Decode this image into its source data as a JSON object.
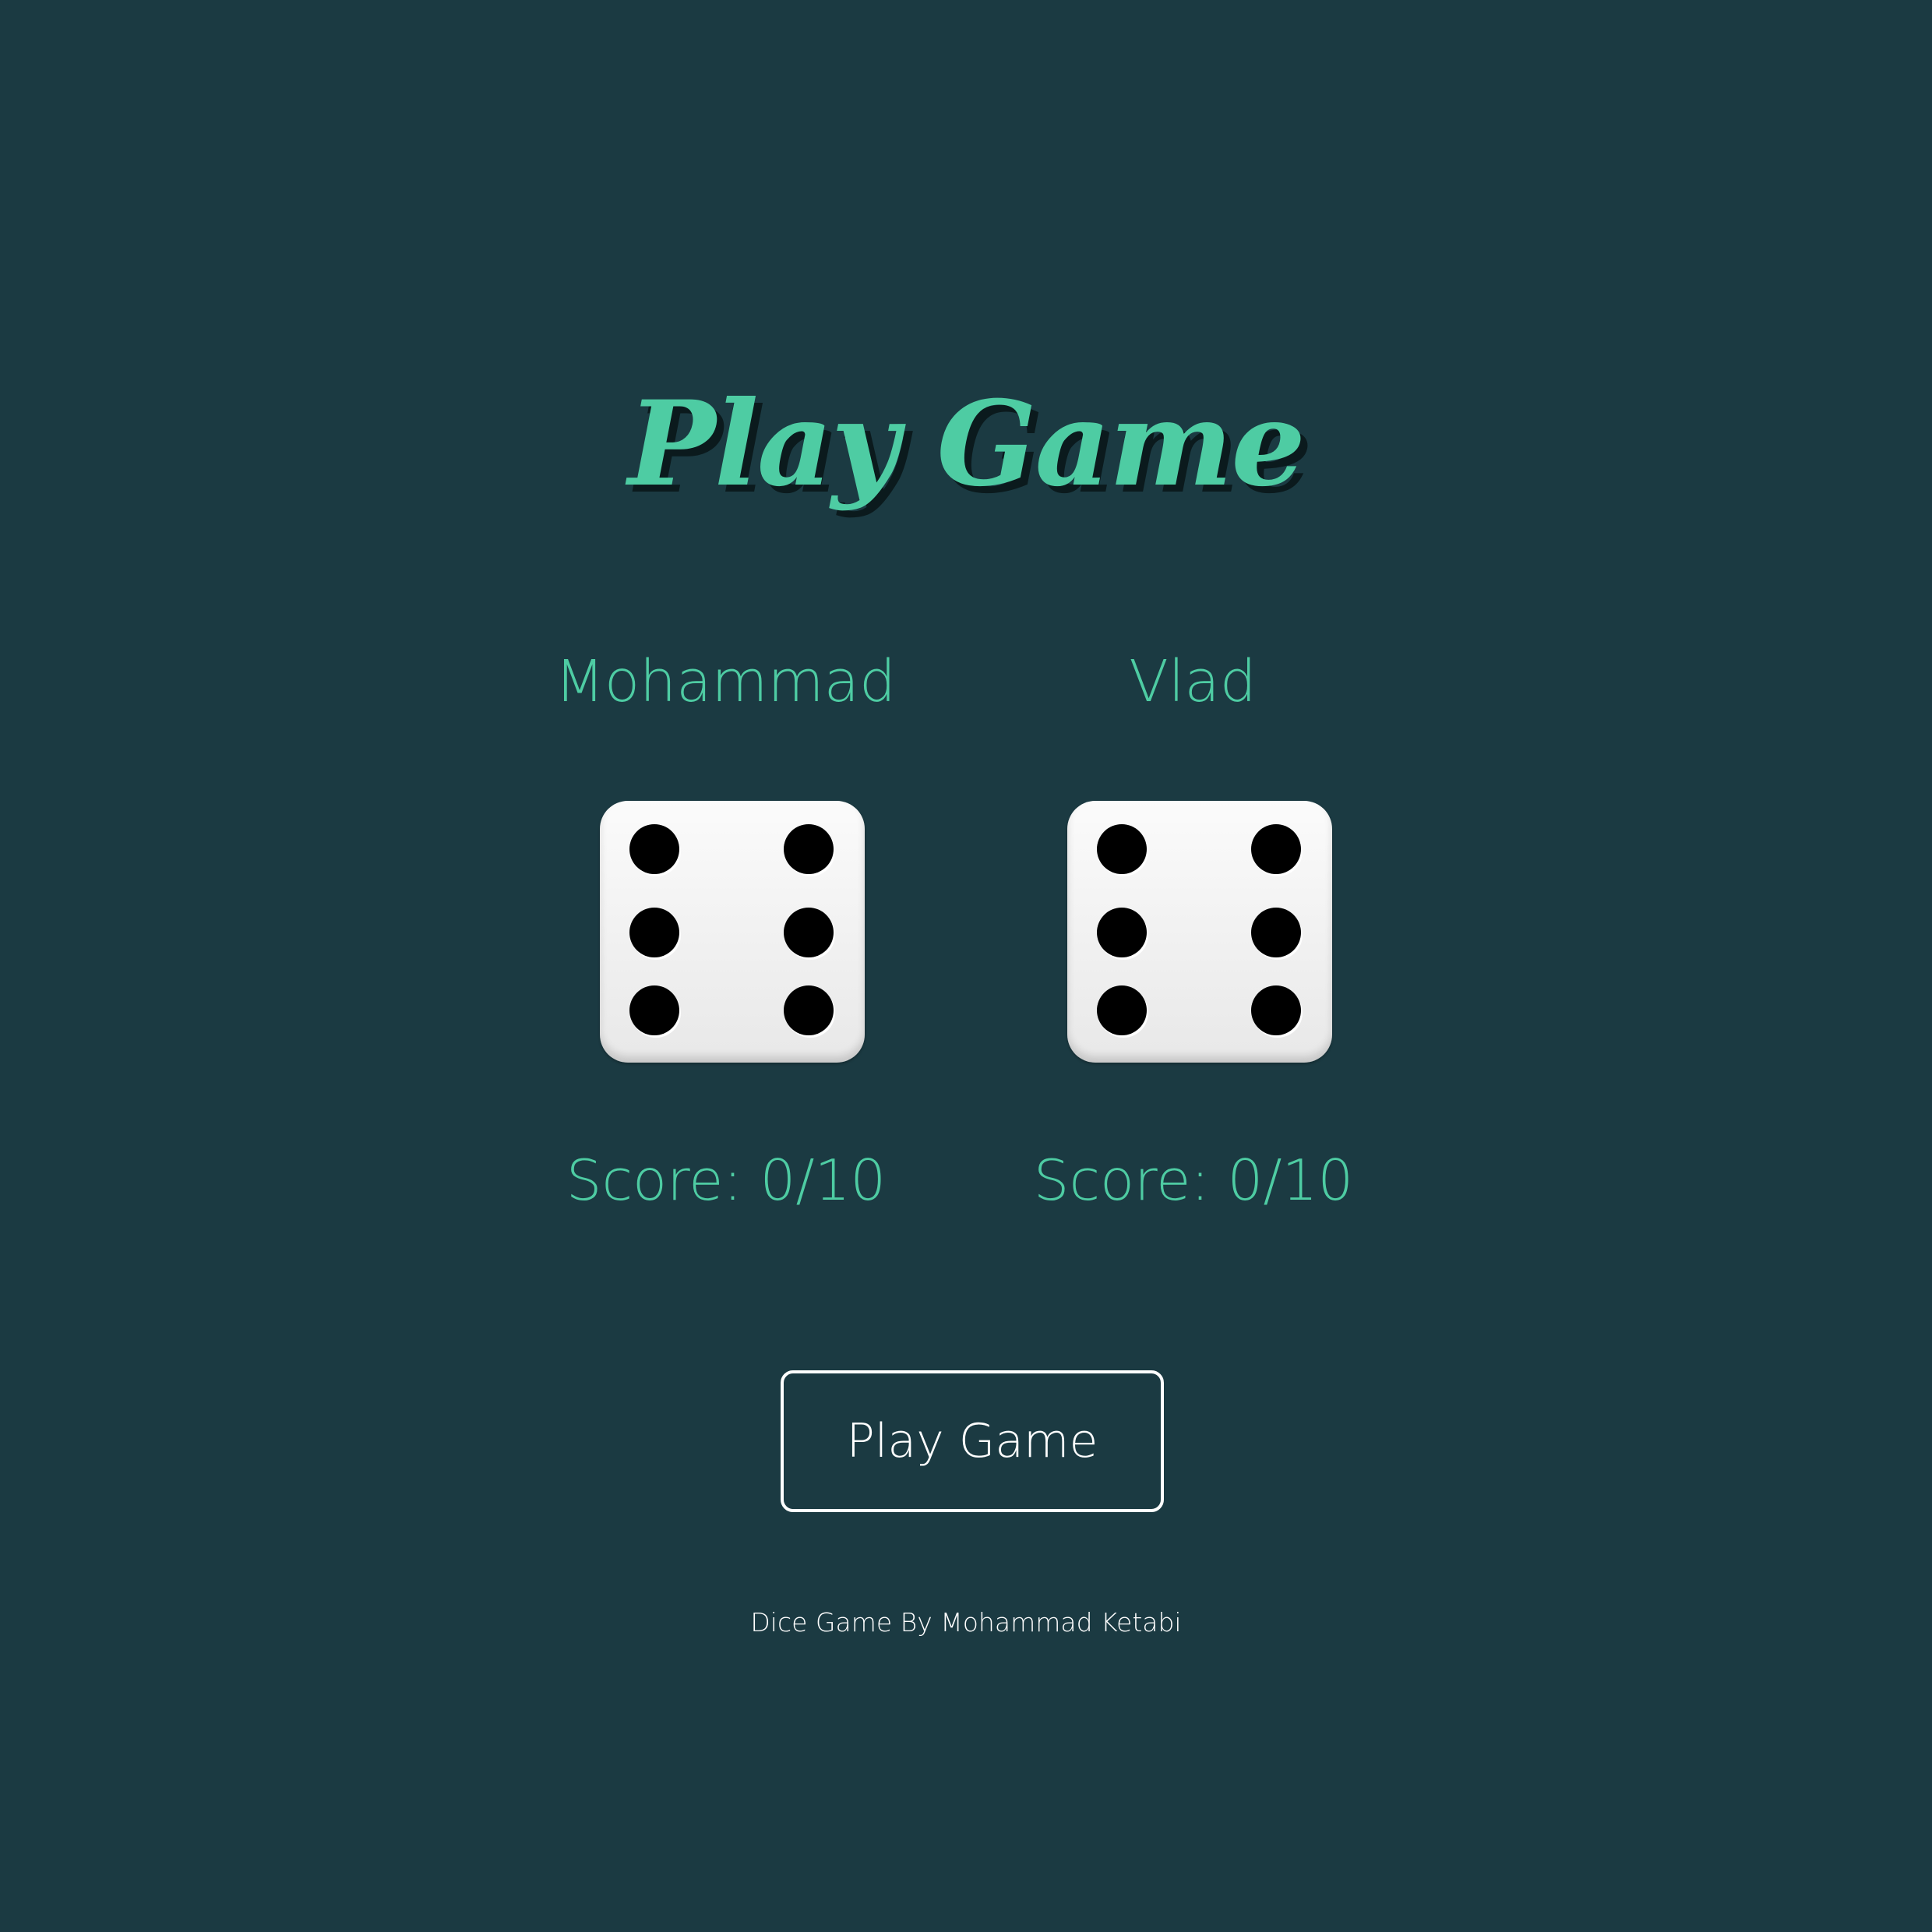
{
  "title": "Play Game",
  "players": [
    {
      "name": "Mohammad",
      "die_value": 6,
      "score": "Score: 0/10"
    },
    {
      "name": "Vlad",
      "die_value": 6,
      "score": "Score: 0/10"
    }
  ],
  "play_button_label": "Play Game",
  "footer": "Dice Game By Mohammad Ketabi",
  "colors": {
    "background": "#1b3a42",
    "accent": "#4ecca3",
    "button_border": "#ffffff",
    "text_light": "#ffffff",
    "die_face": "#f2f2f2",
    "pip": "#000000"
  },
  "icons": [
    "dice-six-icon",
    "dice-six-icon"
  ]
}
